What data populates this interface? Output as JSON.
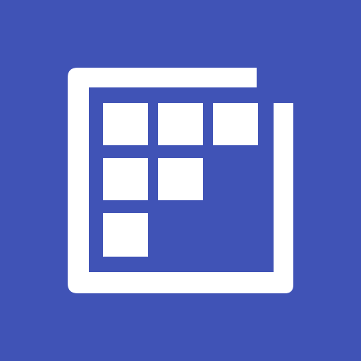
{
  "icon": {
    "name": "calendar-grid-app-icon",
    "background_color": "#4053B6",
    "foreground_color": "#FFFFFF",
    "grid_cells_filled_pattern": [
      [
        true,
        true,
        true
      ],
      [
        true,
        true,
        false
      ],
      [
        true,
        false,
        false
      ]
    ]
  }
}
